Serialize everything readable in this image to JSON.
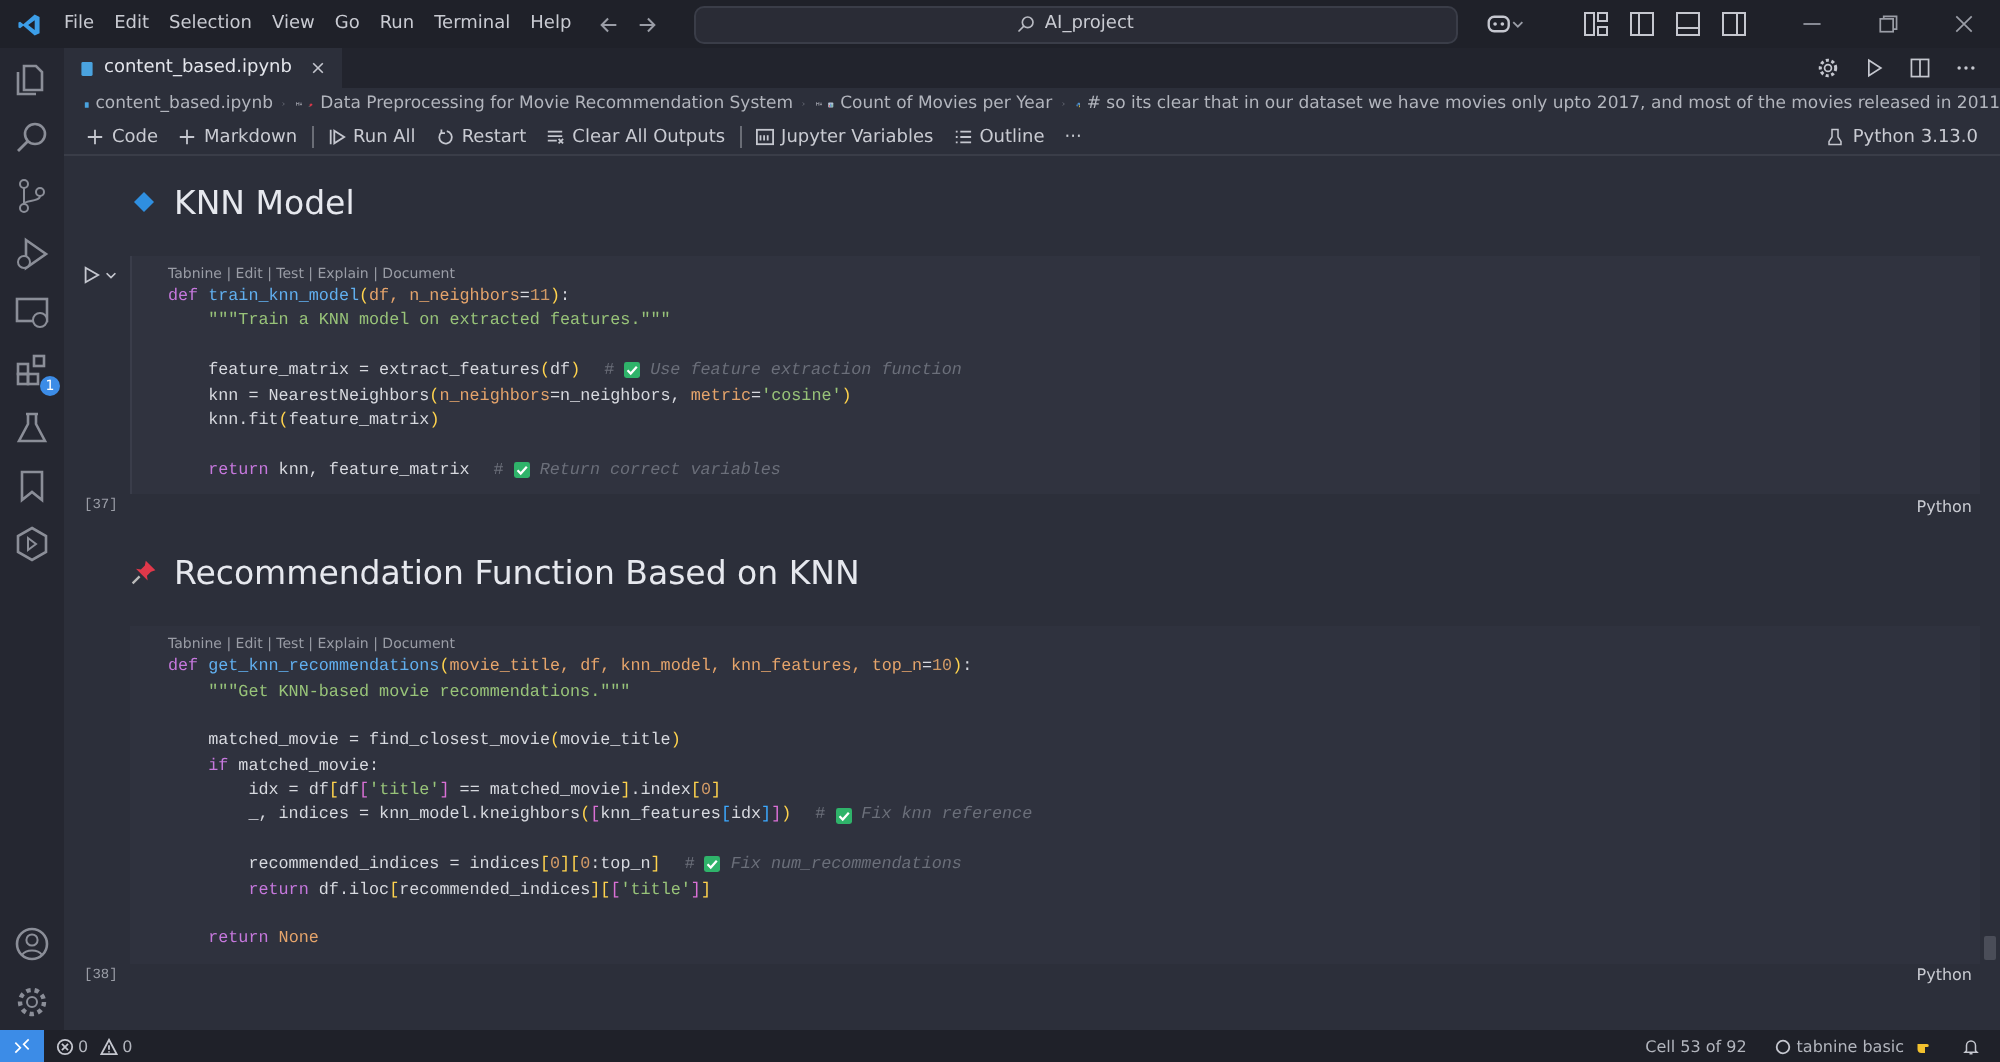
{
  "menu": [
    "File",
    "Edit",
    "Selection",
    "View",
    "Go",
    "Run",
    "Terminal",
    "Help"
  ],
  "command_center": {
    "text": "AI_project"
  },
  "activity_bar": {
    "extensions_badge": "1"
  },
  "tab": {
    "label": "content_based.ipynb",
    "selected": true
  },
  "breadcrumb": [
    {
      "kind": "file",
      "text": "content_based.ipynb"
    },
    {
      "kind": "pin",
      "text": "Data Preprocessing for Movie Recommendation System"
    },
    {
      "kind": "chart",
      "text": "Count of Movies per Year"
    },
    {
      "kind": "code",
      "text": "# so its clear that in our dataset we have movies only upto 2017, and most of the movies released in 2011"
    }
  ],
  "toolbar": [
    {
      "kind": "plus",
      "label": "Code"
    },
    {
      "kind": "plus",
      "label": "Markdown"
    },
    {
      "kind": "run",
      "label": "Run All",
      "separator": true
    },
    {
      "kind": "restart",
      "label": "Restart"
    },
    {
      "kind": "clear",
      "label": "Clear All Outputs"
    },
    {
      "kind": "variables",
      "label": "Jupyter Variables",
      "separator": true
    },
    {
      "kind": "outline",
      "label": "Outline"
    },
    {
      "kind": "more",
      "label": "···"
    }
  ],
  "kernel": "Python 3.13.0",
  "cells": [
    {
      "kind": "bullet",
      "heading": "KNN Model"
    },
    {
      "kind": "code",
      "focused": true,
      "codelens": "Tabnine | Edit | Test | Explain | Document",
      "count": "[37]",
      "language": "Python",
      "lines": [
        {
          "kind": "code",
          "tokens": [
            {
              "kind": "kw",
              "t": "def "
            },
            {
              "kind": "fn",
              "t": "train_knn_model"
            },
            {
              "kind": "br",
              "t": "("
            },
            {
              "kind": "par",
              "t": "df, n_neighbors"
            },
            {
              "kind": "pl",
              "t": "="
            },
            {
              "kind": "num",
              "t": "11"
            },
            {
              "kind": "br",
              "t": ")"
            },
            {
              "kind": "pl",
              "t": ":"
            }
          ]
        },
        {
          "kind": "code",
          "tokens": [
            {
              "kind": "str",
              "t": "    \"\"\"Train a KNN model on extracted features.\"\"\""
            }
          ]
        },
        {
          "kind": "blank"
        },
        {
          "kind": "code",
          "tokens": [
            {
              "kind": "pl",
              "t": "    feature_matrix = extract_features"
            },
            {
              "kind": "br",
              "t": "("
            },
            {
              "kind": "pl",
              "t": "df"
            },
            {
              "kind": "br",
              "t": ")"
            }
          ],
          "comment": {
            "mark": "#",
            "check": true,
            "text": "Use feature extraction function"
          }
        },
        {
          "kind": "code",
          "tokens": [
            {
              "kind": "pl",
              "t": "    knn = NearestNeighbors"
            },
            {
              "kind": "br",
              "t": "("
            },
            {
              "kind": "par",
              "t": "n_neighbors"
            },
            {
              "kind": "pl",
              "t": "=n_neighbors, "
            },
            {
              "kind": "par",
              "t": "metric"
            },
            {
              "kind": "pl",
              "t": "="
            },
            {
              "kind": "str",
              "t": "'cosine'"
            },
            {
              "kind": "br",
              "t": ")"
            }
          ]
        },
        {
          "kind": "code",
          "tokens": [
            {
              "kind": "pl",
              "t": "    knn.fit"
            },
            {
              "kind": "br",
              "t": "("
            },
            {
              "kind": "pl",
              "t": "feature_matrix"
            },
            {
              "kind": "br",
              "t": ")"
            }
          ]
        },
        {
          "kind": "blank"
        },
        {
          "kind": "code",
          "tokens": [
            {
              "kind": "kw",
              "t": "    return"
            },
            {
              "kind": "pl",
              "t": " knn, feature_matrix"
            }
          ],
          "comment": {
            "mark": "#",
            "check": true,
            "text": "Return correct variables"
          }
        }
      ]
    },
    {
      "kind": "pin",
      "heading": "Recommendation Function Based on KNN"
    },
    {
      "kind": "code",
      "focused": false,
      "codelens": "Tabnine | Edit | Test | Explain | Document",
      "count": "[38]",
      "language": "Python",
      "lines": [
        {
          "kind": "code",
          "tokens": [
            {
              "kind": "kw",
              "t": "def "
            },
            {
              "kind": "fn",
              "t": "get_knn_recommendations"
            },
            {
              "kind": "br",
              "t": "("
            },
            {
              "kind": "par",
              "t": "movie_title, df, knn_model, knn_features, top_n"
            },
            {
              "kind": "pl",
              "t": "="
            },
            {
              "kind": "num",
              "t": "10"
            },
            {
              "kind": "br",
              "t": ")"
            },
            {
              "kind": "pl",
              "t": ":"
            }
          ]
        },
        {
          "kind": "code",
          "tokens": [
            {
              "kind": "str",
              "t": "    \"\"\"Get KNN-based movie recommendations.\"\"\""
            }
          ]
        },
        {
          "kind": "blank"
        },
        {
          "kind": "code",
          "tokens": [
            {
              "kind": "pl",
              "t": "    matched_movie = find_closest_movie"
            },
            {
              "kind": "br",
              "t": "("
            },
            {
              "kind": "pl",
              "t": "movie_title"
            },
            {
              "kind": "br",
              "t": ")"
            }
          ]
        },
        {
          "kind": "code",
          "tokens": [
            {
              "kind": "kw",
              "t": "    if"
            },
            {
              "kind": "pl",
              "t": " matched_movie:"
            }
          ]
        },
        {
          "kind": "code",
          "tokens": [
            {
              "kind": "pl",
              "t": "        idx = df"
            },
            {
              "kind": "br",
              "t": "["
            },
            {
              "kind": "pl",
              "t": "df"
            },
            {
              "kind": "br2",
              "t": "["
            },
            {
              "kind": "str",
              "t": "'title'"
            },
            {
              "kind": "br2",
              "t": "]"
            },
            {
              "kind": "pl",
              "t": " == matched_movie"
            },
            {
              "kind": "br",
              "t": "]"
            },
            {
              "kind": "pl",
              "t": ".index"
            },
            {
              "kind": "br",
              "t": "["
            },
            {
              "kind": "num",
              "t": "0"
            },
            {
              "kind": "br",
              "t": "]"
            }
          ]
        },
        {
          "kind": "code",
          "tokens": [
            {
              "kind": "pl",
              "t": "        _, indices = knn_model.kneighbors"
            },
            {
              "kind": "br",
              "t": "("
            },
            {
              "kind": "br2",
              "t": "["
            },
            {
              "kind": "pl",
              "t": "knn_features"
            },
            {
              "kind": "br3",
              "t": "["
            },
            {
              "kind": "pl",
              "t": "idx"
            },
            {
              "kind": "br3",
              "t": "]"
            },
            {
              "kind": "br2",
              "t": "]"
            },
            {
              "kind": "br",
              "t": ")"
            }
          ],
          "comment": {
            "mark": "#",
            "check": true,
            "text": "Fix knn reference"
          }
        },
        {
          "kind": "blank"
        },
        {
          "kind": "code",
          "tokens": [
            {
              "kind": "pl",
              "t": "        recommended_indices = indices"
            },
            {
              "kind": "br",
              "t": "["
            },
            {
              "kind": "num",
              "t": "0"
            },
            {
              "kind": "br",
              "t": "]["
            },
            {
              "kind": "num",
              "t": "0"
            },
            {
              "kind": "pl",
              "t": ":top_n"
            },
            {
              "kind": "br",
              "t": "]"
            }
          ],
          "comment": {
            "mark": "#",
            "check": true,
            "text": "Fix num_recommendations"
          }
        },
        {
          "kind": "code",
          "tokens": [
            {
              "kind": "kw",
              "t": "        return"
            },
            {
              "kind": "pl",
              "t": " df.iloc"
            },
            {
              "kind": "br",
              "t": "["
            },
            {
              "kind": "pl",
              "t": "recommended_indices"
            },
            {
              "kind": "br",
              "t": "]["
            },
            {
              "kind": "br2",
              "t": "["
            },
            {
              "kind": "str",
              "t": "'title'"
            },
            {
              "kind": "br2",
              "t": "]"
            },
            {
              "kind": "br",
              "t": "]"
            }
          ]
        },
        {
          "kind": "blank"
        },
        {
          "kind": "code",
          "tokens": [
            {
              "kind": "kw",
              "t": "    return"
            },
            {
              "kind": "const",
              "t": " None"
            }
          ]
        }
      ]
    }
  ],
  "status_bar": {
    "errors": "0",
    "warnings": "0",
    "cell_position": "Cell 53 of 92",
    "tabnine": "tabnine basic"
  }
}
